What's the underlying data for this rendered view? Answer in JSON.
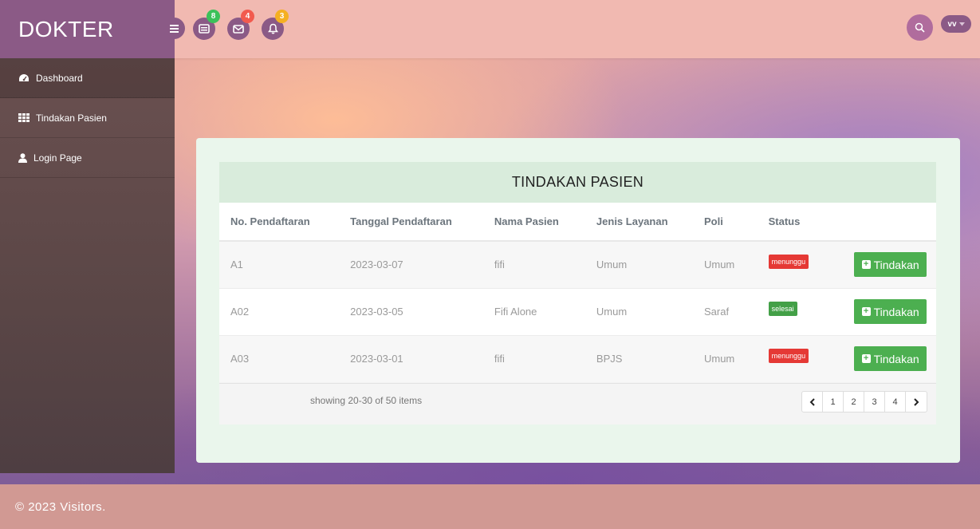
{
  "brand": "DOKTER",
  "topbar": {
    "menu_icon": "hamburger-icon",
    "icons": [
      {
        "name": "inbox-icon",
        "badge": "8",
        "badge_color": "#3cc15a"
      },
      {
        "name": "mail-icon",
        "badge": "4",
        "badge_color": "#f25a4e"
      },
      {
        "name": "bell-icon",
        "badge": "3",
        "badge_color": "#f5b022"
      }
    ],
    "user_initials": "vv"
  },
  "sidebar": {
    "items": [
      {
        "label": "Dashboard",
        "icon": "dashboard-icon"
      },
      {
        "label": "Tindakan Pasien",
        "icon": "table-icon"
      },
      {
        "label": "Login Page",
        "icon": "user-icon"
      }
    ]
  },
  "panel": {
    "title": "TINDAKAN PASIEN",
    "columns": [
      "No. Pendaftaran",
      "Tanggal Pendaftaran",
      "Nama Pasien",
      "Jenis Layanan",
      "Poli",
      "Status"
    ],
    "rows": [
      {
        "no": "A1",
        "tanggal": "2023-03-07",
        "nama": "fifi",
        "layanan": "Umum",
        "poli": "Umum",
        "status": "menunggu",
        "status_color": "#e53935",
        "action": "Tindakan"
      },
      {
        "no": "A02",
        "tanggal": "2023-03-05",
        "nama": "Fifi Alone",
        "layanan": "Umum",
        "poli": "Saraf",
        "status": "selesai",
        "status_color": "#43a047",
        "action": "Tindakan"
      },
      {
        "no": "A03",
        "tanggal": "2023-03-01",
        "nama": "fifi",
        "layanan": "BPJS",
        "poli": "Umum",
        "status": "menunggu",
        "status_color": "#e53935",
        "action": "Tindakan"
      }
    ],
    "showing": "showing 20-30 of 50 items",
    "pages": [
      "1",
      "2",
      "3",
      "4"
    ]
  },
  "footer": "© 2023 Visitors."
}
